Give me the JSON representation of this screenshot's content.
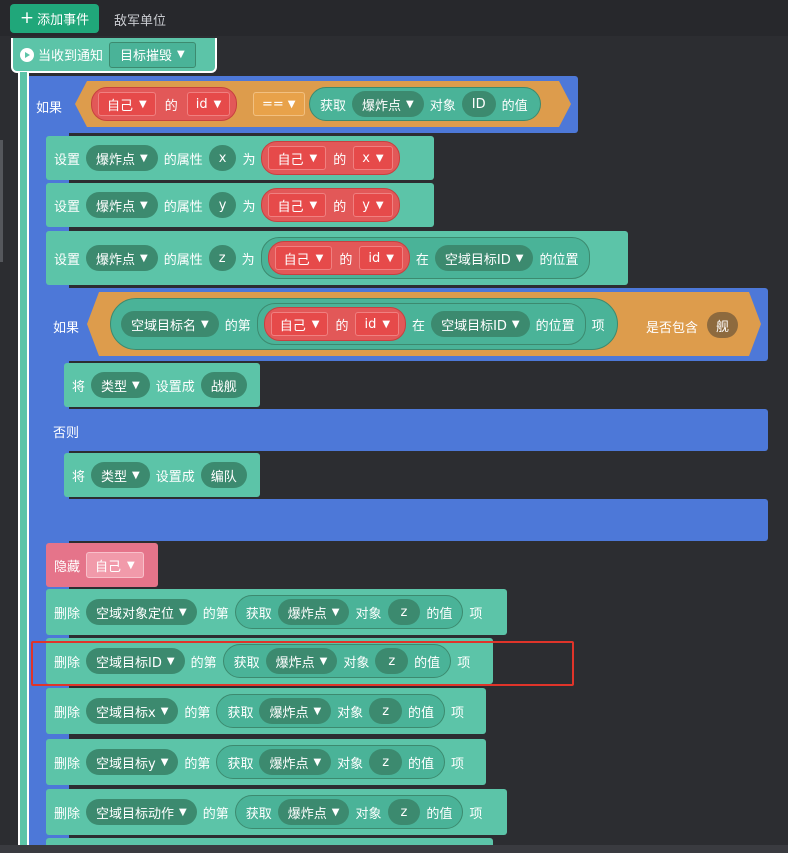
{
  "topbar": {
    "add_event": "添加事件",
    "enemy_unit": "敌军单位",
    "plus": "+"
  },
  "hat": {
    "label": "当收到通知",
    "notice": "目标摧毁"
  },
  "if1": {
    "label": "如果",
    "self": "自己",
    "of": "的",
    "id": "id",
    "op": "==",
    "get": "获取",
    "explode": "爆炸点",
    "object": "对象",
    "ID": "ID",
    "value": "的值"
  },
  "set1": {
    "set": "设置",
    "explode": "爆炸点",
    "prop": "的属性",
    "x": "x",
    "as": "为",
    "self": "自己",
    "of": "的",
    "xv": "x"
  },
  "set2": {
    "set": "设置",
    "explode": "爆炸点",
    "prop": "的属性",
    "y": "y",
    "as": "为",
    "self": "自己",
    "of": "的",
    "yv": "y"
  },
  "set3": {
    "set": "设置",
    "explode": "爆炸点",
    "prop": "的属性",
    "z": "z",
    "as": "为",
    "self": "自己",
    "of": "的",
    "id": "id",
    "at": "在",
    "list": "空域目标ID",
    "pos": "的位置"
  },
  "if2": {
    "label": "如果",
    "name": "空域目标名",
    "nth": "的第",
    "self": "自己",
    "of": "的",
    "id": "id",
    "at": "在",
    "list": "空域目标ID",
    "pos": "的位置",
    "item": "项",
    "contains": "是否包含",
    "ship": "舰"
  },
  "then1": {
    "will": "将",
    "type": "类型",
    "setto": "设置成",
    "val": "战舰"
  },
  "else": {
    "label": "否则"
  },
  "then2": {
    "will": "将",
    "type": "类型",
    "setto": "设置成",
    "val": "编队"
  },
  "hide": {
    "label": "隐藏",
    "self": "自己"
  },
  "del": [
    {
      "del": "删除",
      "list": "空域对象定位",
      "nth": "的第",
      "get": "获取",
      "explode": "爆炸点",
      "object": "对象",
      "z": "z",
      "value": "的值",
      "item": "项"
    },
    {
      "del": "删除",
      "list": "空域目标ID",
      "nth": "的第",
      "get": "获取",
      "explode": "爆炸点",
      "object": "对象",
      "z": "z",
      "value": "的值",
      "item": "项"
    },
    {
      "del": "删除",
      "list": "空域目标x",
      "nth": "的第",
      "get": "获取",
      "explode": "爆炸点",
      "object": "对象",
      "z": "z",
      "value": "的值",
      "item": "项"
    },
    {
      "del": "删除",
      "list": "空域目标y",
      "nth": "的第",
      "get": "获取",
      "explode": "爆炸点",
      "object": "对象",
      "z": "z",
      "value": "的值",
      "item": "项"
    },
    {
      "del": "删除",
      "list": "空域目标动作",
      "nth": "的第",
      "get": "获取",
      "explode": "爆炸点",
      "object": "对象",
      "z": "z",
      "value": "的值",
      "item": "项"
    }
  ],
  "icons": {
    "dropdown": "▼",
    "play": "▶"
  },
  "colors": {
    "teal": "#5cc4a8",
    "blue": "#4d78d8",
    "orange": "#dd9c4c",
    "red": "#e64a4a",
    "highlight": "#e0342a"
  }
}
